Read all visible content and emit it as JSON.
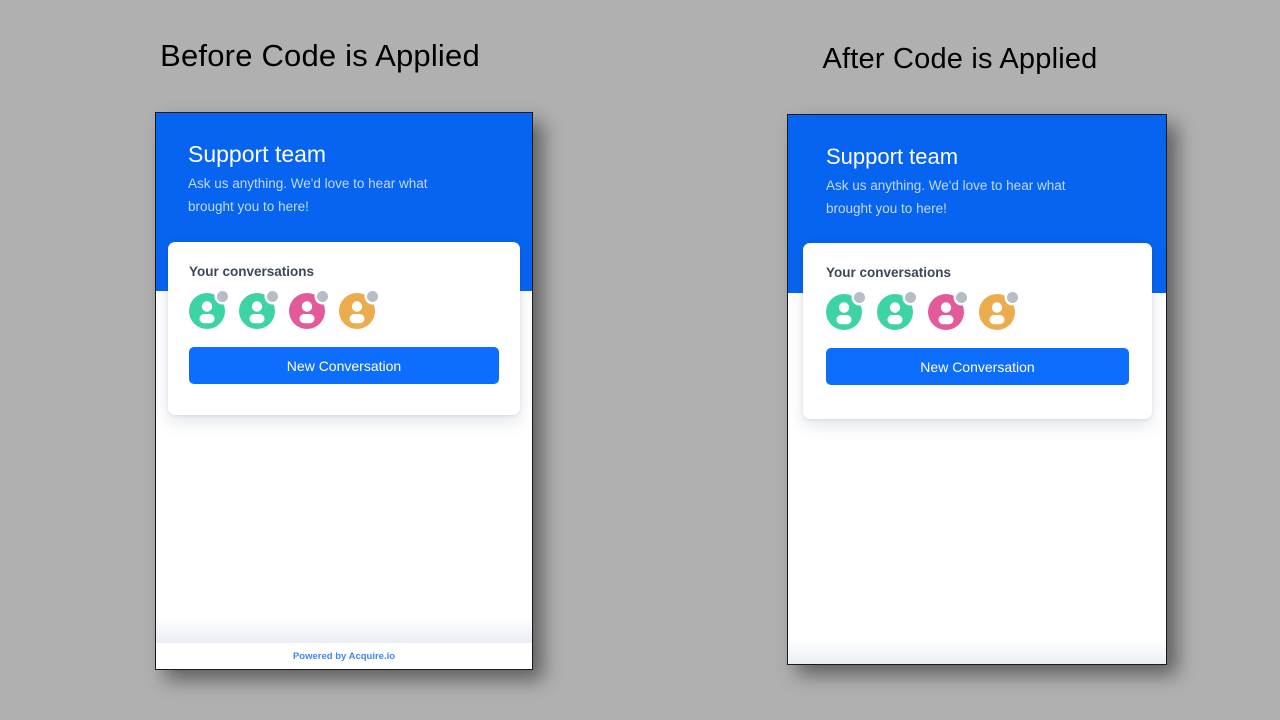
{
  "background_color": "#b0b0b0",
  "accent_color": "#0764f0",
  "button_color": "#0d6efd",
  "panels": [
    {
      "title": "Before Code is Applied",
      "widget": {
        "header": {
          "title": "Support team",
          "subtitle": "Ask us anything. We'd love to hear what brought you to here!"
        },
        "conversations": {
          "label": "Your conversations",
          "avatars": [
            {
              "name": "avatar-1",
              "color": "#3dd3a5",
              "status_color": "#b6bdc6"
            },
            {
              "name": "avatar-2",
              "color": "#3dd3a5",
              "status_color": "#b6bdc6"
            },
            {
              "name": "avatar-3",
              "color": "#e35a9b",
              "status_color": "#b6bdc6"
            },
            {
              "name": "avatar-4",
              "color": "#eaac4d",
              "status_color": "#b6bdc6"
            }
          ],
          "new_conversation_label": "New Conversation"
        },
        "footer": {
          "visible": true,
          "text": "Powered by Acquire.io",
          "color": "#3d87f5"
        }
      }
    },
    {
      "title": "After Code is Applied",
      "widget": {
        "header": {
          "title": "Support team",
          "subtitle": "Ask us anything. We'd love to hear what brought you to here!"
        },
        "conversations": {
          "label": "Your conversations",
          "avatars": [
            {
              "name": "avatar-1",
              "color": "#3dd3a5",
              "status_color": "#b6bdc6"
            },
            {
              "name": "avatar-2",
              "color": "#3dd3a5",
              "status_color": "#b6bdc6"
            },
            {
              "name": "avatar-3",
              "color": "#e35a9b",
              "status_color": "#b6bdc6"
            },
            {
              "name": "avatar-4",
              "color": "#eaac4d",
              "status_color": "#b6bdc6"
            }
          ],
          "new_conversation_label": "New Conversation"
        },
        "footer": {
          "visible": false,
          "text": "",
          "color": "#3d87f5"
        }
      }
    }
  ]
}
